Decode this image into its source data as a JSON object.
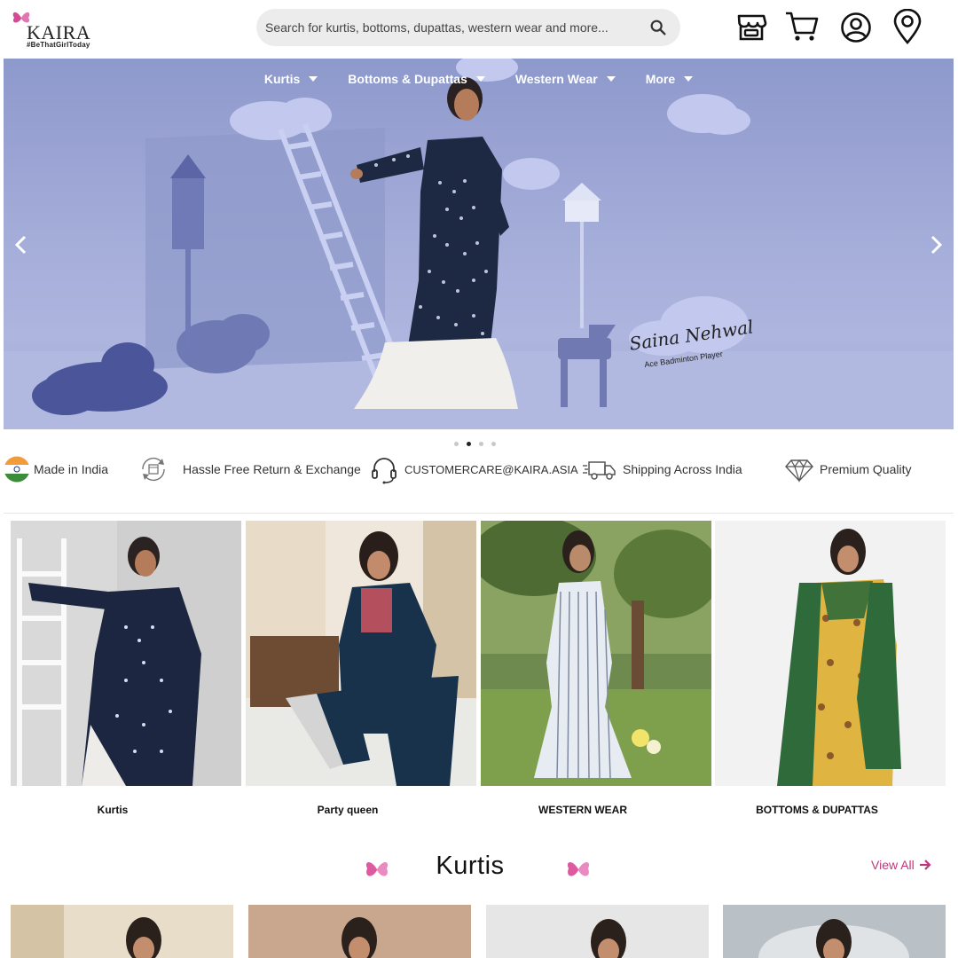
{
  "header": {
    "brand": "KAIRA",
    "tagline": "#BeThatGirlToday",
    "search_placeholder": "Search for kurtis, bottoms, dupattas, western wear and more...",
    "icons": [
      "store-icon",
      "cart-icon",
      "account-icon",
      "location-icon"
    ]
  },
  "nav": {
    "items": [
      {
        "label": "Kurtis"
      },
      {
        "label": "Bottoms & Dupattas"
      },
      {
        "label": "Western Wear"
      },
      {
        "label": "More"
      }
    ]
  },
  "hero": {
    "signature": "Saina Nehwal",
    "caption": "Ace Badminton Player",
    "slides_count": 4,
    "active_slide": 2
  },
  "features": [
    {
      "label": "Made in India",
      "icon": "india-flag-icon"
    },
    {
      "label": "Hassle Free Return & Exchange",
      "icon": "return-exchange-icon"
    },
    {
      "label": "CUSTOMERCARE@KAIRA.ASIA",
      "icon": "headset-icon"
    },
    {
      "label": "Shipping Across India",
      "icon": "delivery-truck-icon"
    },
    {
      "label": "Premium Quality",
      "icon": "diamond-icon"
    }
  ],
  "categories": [
    {
      "label": "Kurtis"
    },
    {
      "label": "Party queen"
    },
    {
      "label": "WESTERN WEAR"
    },
    {
      "label": "BOTTOMS & DUPATTAS"
    }
  ],
  "section": {
    "title": "Kurtis",
    "view_all": "View All"
  },
  "colors": {
    "accent": "#c0367c",
    "hero_bg": "#a3abd8"
  }
}
